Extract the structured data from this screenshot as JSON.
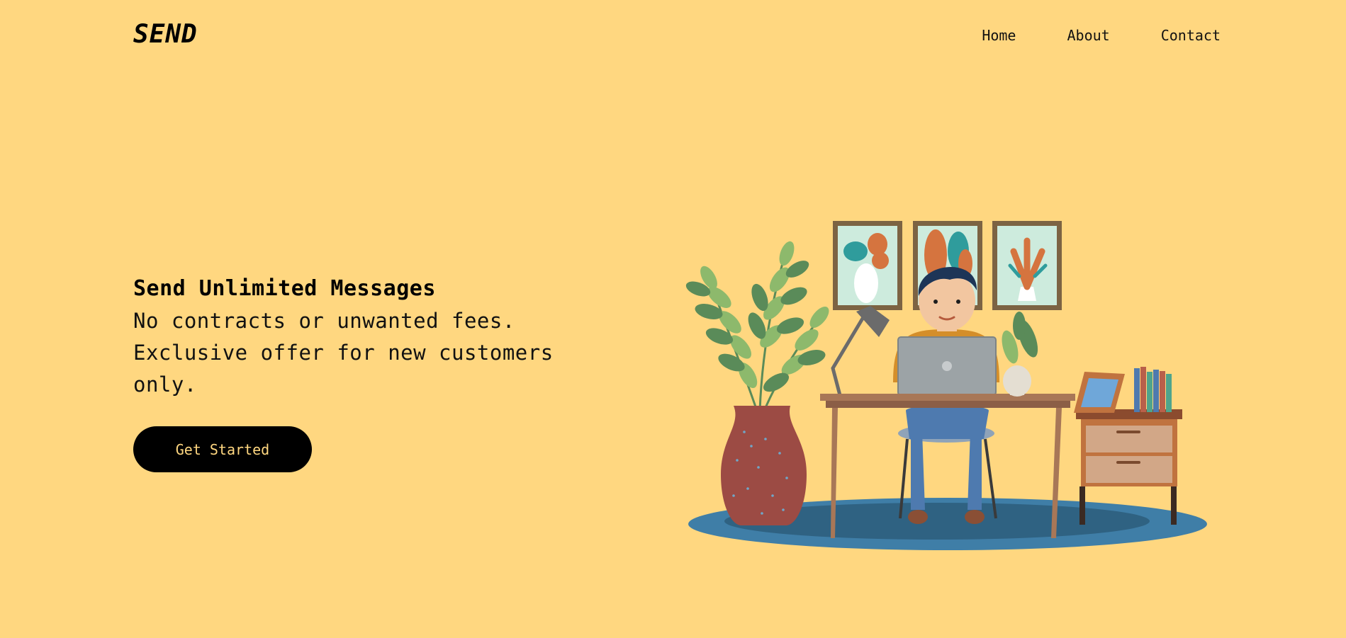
{
  "header": {
    "logo": "SEND",
    "nav": [
      {
        "label": "Home"
      },
      {
        "label": "About"
      },
      {
        "label": "Contact"
      }
    ]
  },
  "hero": {
    "title": "Send Unlimited Messages",
    "subtitle": "No contracts or unwanted fees. Exclusive offer for new customers only.",
    "cta_label": "Get Started"
  },
  "colors": {
    "background": "#FFD780",
    "cta_background": "#000000",
    "cta_text": "#FFD780",
    "rug": "#3F7EA7",
    "rug_inner": "#2F6282",
    "desk": "#8B5E46",
    "vase": "#9C4B44",
    "leaf_light": "#8DB96C",
    "leaf_dark": "#5A8B59",
    "frame": "#7C6343",
    "art_bg": "#CDEBDD"
  },
  "illustration": {
    "icon": "person-working-at-desk-illustration"
  }
}
